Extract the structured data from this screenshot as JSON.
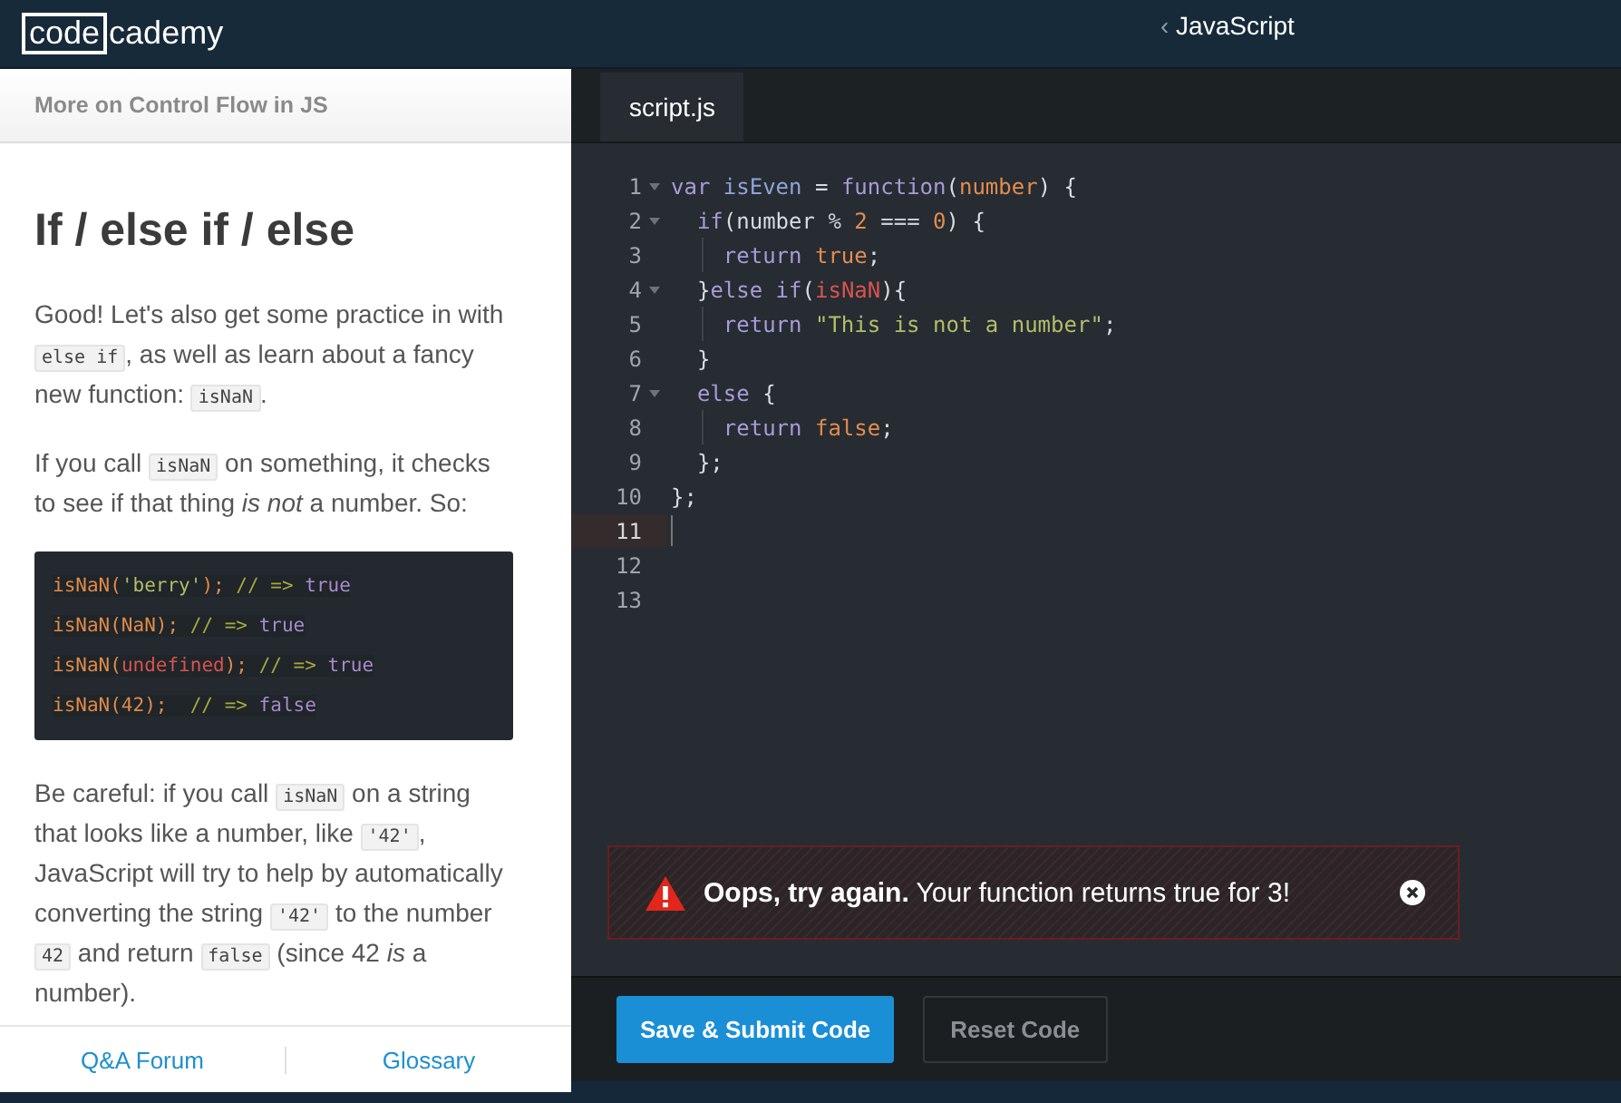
{
  "header": {
    "logo_boxed": "code",
    "logo_rest": "cademy",
    "course": "JavaScript",
    "back_icon": "‹"
  },
  "lesson": {
    "section": "More on Control Flow in JS",
    "title": "If / else if / else",
    "paragraphs": [
      [
        {
          "kind": "text",
          "text": "Good! Let's also get some practice in with "
        },
        {
          "kind": "code",
          "text": "else if"
        },
        {
          "kind": "text",
          "text": ", as well as learn about a fancy new function: "
        },
        {
          "kind": "code",
          "text": "isNaN"
        },
        {
          "kind": "text",
          "text": "."
        }
      ],
      [
        {
          "kind": "text",
          "text": "If you call "
        },
        {
          "kind": "code",
          "text": "isNaN"
        },
        {
          "kind": "text",
          "text": " on something, it checks to see if that thing *is not* a number. So:"
        }
      ]
    ],
    "example": [
      [
        {
          "kind": "fn",
          "text": "isNaN("
        },
        {
          "kind": "str",
          "text": "'berry'"
        },
        {
          "kind": "fn",
          "text": ");"
        },
        {
          "kind": "cm",
          "text": " // => "
        },
        {
          "kind": "bool",
          "text": "true"
        }
      ],
      [
        {
          "kind": "fn",
          "text": "isNaN(NaN);"
        },
        {
          "kind": "cm",
          "text": " // => "
        },
        {
          "kind": "bool",
          "text": "true"
        }
      ],
      [
        {
          "kind": "fn",
          "text": "isNaN("
        },
        {
          "kind": "red",
          "text": "undefined"
        },
        {
          "kind": "fn",
          "text": ");"
        },
        {
          "kind": "cm",
          "text": " // => "
        },
        {
          "kind": "bool",
          "text": "true"
        }
      ],
      [
        {
          "kind": "fn",
          "text": "isNaN(42);"
        },
        {
          "kind": "cm",
          "text": "  // => "
        },
        {
          "kind": "bool",
          "text": "false"
        }
      ]
    ],
    "after": [
      [
        {
          "kind": "text",
          "text": "Be careful: if you call "
        },
        {
          "kind": "code",
          "text": "isNaN"
        },
        {
          "kind": "text",
          "text": " on a string that looks like a number, like "
        },
        {
          "kind": "code",
          "text": "'42'"
        },
        {
          "kind": "text",
          "text": ", JavaScript will try to help by automatically converting the string "
        },
        {
          "kind": "code",
          "text": "'42'"
        },
        {
          "kind": "text",
          "text": " to the number "
        },
        {
          "kind": "code",
          "text": "42"
        },
        {
          "kind": "text",
          "text": " and return "
        },
        {
          "kind": "code",
          "text": "false"
        },
        {
          "kind": "text",
          "text": " (since 42 *is* a number)."
        }
      ]
    ],
    "footer_links": [
      "Q&A Forum",
      "Glossary"
    ]
  },
  "editor": {
    "tabs": [
      {
        "label": "script.js",
        "selected": true
      }
    ],
    "lines": [
      {
        "n": "1",
        "fold": true,
        "active": false,
        "tokens": [
          {
            "kind": "kw",
            "text": "var "
          },
          {
            "kind": "name",
            "text": "isEven"
          },
          {
            "kind": "plain",
            "text": " = "
          },
          {
            "kind": "kw",
            "text": "function"
          },
          {
            "kind": "plain",
            "text": "("
          },
          {
            "kind": "param",
            "text": "number"
          },
          {
            "kind": "plain",
            "text": ") {"
          }
        ]
      },
      {
        "n": "2",
        "fold": true,
        "active": false,
        "tokens": [
          {
            "kind": "kw",
            "text": "  if"
          },
          {
            "kind": "plain",
            "text": "(number "
          },
          {
            "kind": "op",
            "text": "% "
          },
          {
            "kind": "num",
            "text": "2"
          },
          {
            "kind": "op",
            "text": " === "
          },
          {
            "kind": "num",
            "text": "0"
          },
          {
            "kind": "plain",
            "text": ") {"
          }
        ]
      },
      {
        "n": "3",
        "fold": false,
        "active": false,
        "tokens": [
          {
            "kind": "kw",
            "text": "    return "
          },
          {
            "kind": "num",
            "text": "true"
          },
          {
            "kind": "plain",
            "text": ";"
          }
        ]
      },
      {
        "n": "4",
        "fold": true,
        "active": false,
        "tokens": [
          {
            "kind": "plain",
            "text": "  }"
          },
          {
            "kind": "kw",
            "text": "else if"
          },
          {
            "kind": "plain",
            "text": "("
          },
          {
            "kind": "red",
            "text": "isNaN"
          },
          {
            "kind": "plain",
            "text": "){"
          }
        ]
      },
      {
        "n": "5",
        "fold": false,
        "active": false,
        "tokens": [
          {
            "kind": "kw",
            "text": "    return "
          },
          {
            "kind": "str",
            "text": "\"This is not a number\""
          },
          {
            "kind": "plain",
            "text": ";"
          }
        ]
      },
      {
        "n": "6",
        "fold": false,
        "active": false,
        "tokens": [
          {
            "kind": "plain",
            "text": "  }"
          }
        ]
      },
      {
        "n": "7",
        "fold": true,
        "active": false,
        "tokens": [
          {
            "kind": "kw",
            "text": "  else "
          },
          {
            "kind": "plain",
            "text": "{"
          }
        ]
      },
      {
        "n": "8",
        "fold": false,
        "active": false,
        "tokens": [
          {
            "kind": "kw",
            "text": "    return "
          },
          {
            "kind": "num",
            "text": "false"
          },
          {
            "kind": "plain",
            "text": ";"
          }
        ]
      },
      {
        "n": "9",
        "fold": false,
        "active": false,
        "tokens": [
          {
            "kind": "plain",
            "text": "  };"
          }
        ]
      },
      {
        "n": "10",
        "fold": false,
        "active": false,
        "tokens": [
          {
            "kind": "plain",
            "text": "};"
          }
        ]
      },
      {
        "n": "11",
        "fold": false,
        "active": true
      },
      {
        "n": "12",
        "fold": false,
        "active": false
      },
      {
        "n": "13",
        "fold": false,
        "active": false
      }
    ],
    "error": {
      "message": "**Oops, try again.** Your function returns true for 3!"
    },
    "buttons": [
      {
        "label": "Save & Submit Code",
        "kind": "primary"
      },
      {
        "label": "Reset Code",
        "kind": "secondary"
      }
    ]
  }
}
